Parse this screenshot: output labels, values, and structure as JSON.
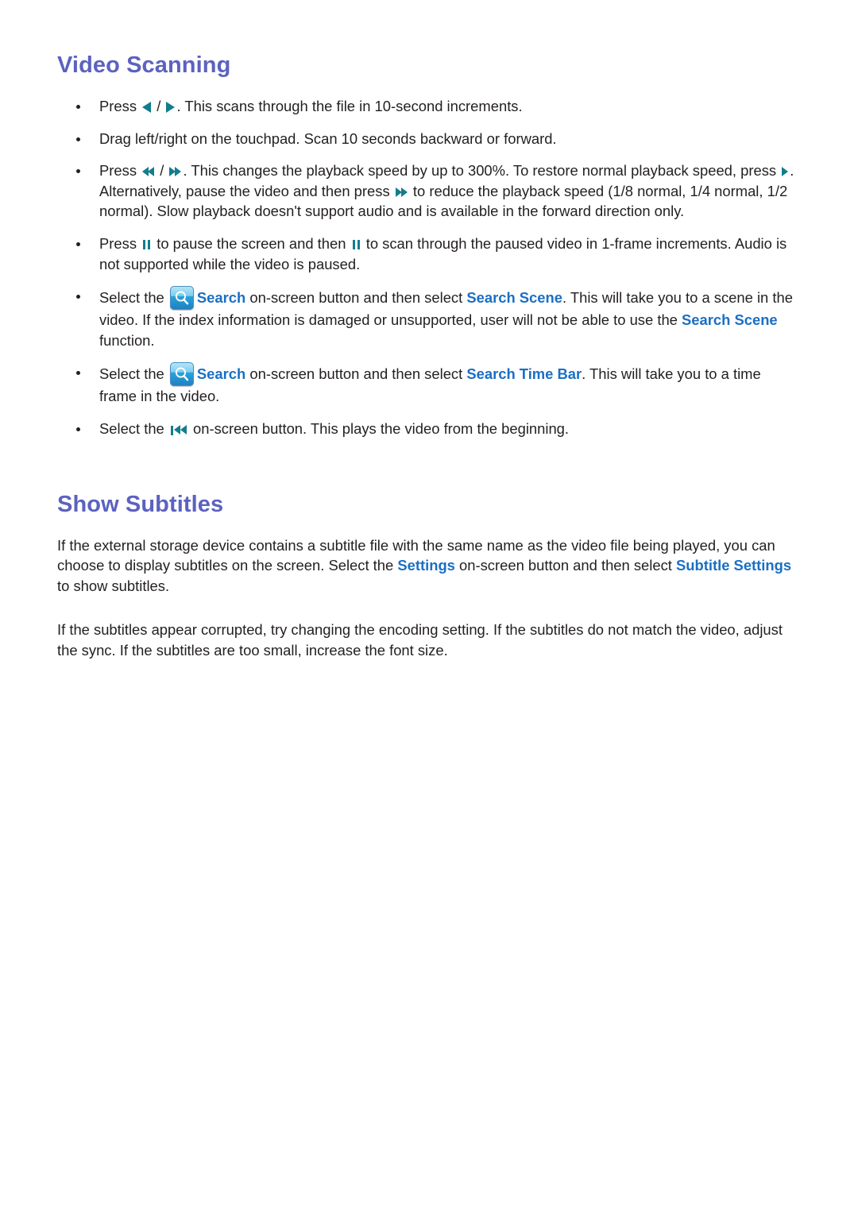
{
  "document": {
    "sections": [
      {
        "heading": "Video Scanning",
        "bullets": [
          {
            "id": "scan-10-second",
            "parts": [
              {
                "t": "text",
                "v": "Press "
              },
              {
                "t": "icon",
                "v": "rewind-step-icon"
              },
              {
                "t": "text",
                "v": " / "
              },
              {
                "t": "icon",
                "v": "forward-step-icon"
              },
              {
                "t": "text",
                "v": ". This scans through the file in 10-second increments."
              }
            ],
            "plain": "Press ◀ / ▶. This scans through the file in 10-second increments."
          },
          {
            "id": "drag-touchpad",
            "plain": "Drag left/right on the touchpad. Scan 10 seconds backward or forward."
          },
          {
            "id": "playback-speed",
            "plain": "Press ◀◀ / ▶▶. This changes the playback speed by up to 300%. To restore normal playback speed, press ▶. Alternatively, pause the video and then press ▶▶ to reduce the playback speed (1/8 normal, 1/4 normal, 1/2 normal). Slow playback doesn't support audio and is available in the forward direction only."
          },
          {
            "id": "frame-step",
            "plain": "Press ❚❚ to pause the screen and then ❚❚ to scan through the paused video in 1-frame increments. Audio is not supported while the video is paused."
          },
          {
            "id": "search-scene",
            "plain": "Select the [Search icon] Search on-screen button and then select Search Scene. This will take you to a scene in the video. If the index information is damaged or unsupported, user will not be able to use the Search Scene function."
          },
          {
            "id": "search-time-bar",
            "plain": "Select the [Search icon] Search on-screen button and then select Search Time Bar. This will take you to a time frame in the video."
          },
          {
            "id": "play-from-beginning",
            "plain": "Select the ❚◀◀ on-screen button. This plays the video from the beginning."
          }
        ],
        "text": {
          "press": "Press ",
          "slash": " / ",
          "scan_10s_tail": ". This scans through the file in 10-second increments.",
          "drag_touchpad": "Drag left/right on the touchpad. Scan 10 seconds backward or forward.",
          "speed_part1": ". This changes the playback speed by up to 300%. To restore normal playback speed, press ",
          "speed_part2": ". Alternatively, pause the video and then press ",
          "speed_part3": " to reduce the playback speed (1/8 normal, 1/4 normal, 1/2 normal). Slow playback doesn't support audio and is available in the forward direction only.",
          "pause_part1": " to pause the screen and then ",
          "pause_part2": " to scan through the paused video in 1-frame increments. Audio is not supported while the video is paused.",
          "select_the": "Select the ",
          "search_label": "Search",
          "scene_mid": " on-screen button and then select ",
          "search_scene_ref": "Search Scene",
          "scene_tail": ". This will take you to a scene in the video. If the index information is damaged or unsupported, user will not be able to use the ",
          "search_scene_ref2": "Search Scene",
          "scene_tail2": " function.",
          "search_time_bar_ref": "Search Time Bar",
          "time_bar_tail": ". This will take you to a time frame in the video.",
          "beginning_tail": " on-screen button. This plays the video from the beginning."
        }
      },
      {
        "heading": "Show Subtitles",
        "paragraphs": [
          {
            "id": "subtitle-file-info",
            "plain": "If the external storage device contains a subtitle file with the same name as the video file being played, you can choose to display subtitles on the screen. Select the Settings on-screen button and then select Subtitle Settings to show subtitles.",
            "text": {
              "p1": "If the external storage device contains a subtitle file with the same name as the video file being played, you can choose to display subtitles on the screen. Select the ",
              "settings_ref": "Settings",
              "p2": " on-screen button and then select ",
              "subtitle_settings_ref": "Subtitle Settings",
              "p3": " to show subtitles."
            }
          },
          {
            "id": "subtitle-troubleshooting",
            "plain": "If the subtitles appear corrupted, try changing the encoding setting. If the subtitles do not match the video, adjust the sync. If the subtitles are too small, increase the font size."
          }
        ]
      }
    ]
  },
  "colors": {
    "heading": "#5b62c0",
    "ui_reference": "#1a6fc4",
    "glyph": "#127d8c",
    "body_text": "#231f20",
    "icon_button_top": "#b9e6f7",
    "icon_button_bottom": "#1f7ec0"
  },
  "icons": {
    "rewind_step": "rewind-step-icon",
    "forward_step": "forward-step-icon",
    "rewind_fast": "fast-rewind-icon",
    "forward_fast": "fast-forward-icon",
    "play": "play-icon",
    "pause": "pause-icon",
    "skip_to_start": "skip-to-start-icon",
    "search_button": "search-button-icon"
  }
}
